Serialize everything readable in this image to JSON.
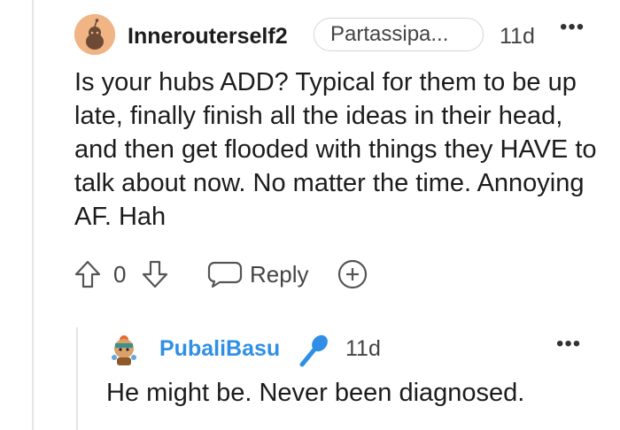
{
  "comment": {
    "username": "Innerouterself2",
    "flair": "Partassipa...",
    "time": "11d",
    "more": "•••",
    "body": "Is your hubs ADD? Typical for them to be up late, finally finish all the ideas in their head, and then get flooded with things they HAVE to talk about now. No matter the time. Annoying AF. Hah",
    "votes": "0",
    "reply_label": "Reply"
  },
  "reply": {
    "username": "PubaliBasu",
    "time": "11d",
    "more": "•••",
    "body": "He might be. Never been diagnosed."
  },
  "colors": {
    "username_reply": "#2f8fe6",
    "avatar_bg": "#f0b485",
    "thread_line": "#e5e5e5"
  },
  "icons": {
    "upvote": "arrow-up-outline-icon",
    "downvote": "arrow-down-outline-icon",
    "reply": "chat-bubble-icon",
    "award": "plus-circle-icon",
    "mic": "microphone-icon"
  }
}
